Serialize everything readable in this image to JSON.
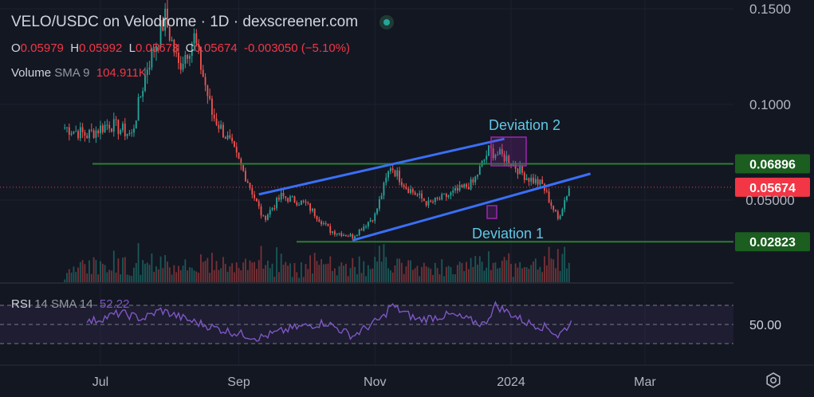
{
  "header": {
    "title": "VELO/USDC on Velodrome · 1D · dexscreener.com",
    "ohlc": [
      {
        "k": "O",
        "v": "0.05979"
      },
      {
        "k": "H",
        "v": "0.05992"
      },
      {
        "k": "L",
        "v": "0.05673"
      },
      {
        "k": "C",
        "v": "0.05674"
      }
    ],
    "change": "-0.003050 (−5.10%)",
    "volume_label": "Volume",
    "volume_sma": "SMA 9",
    "volume_value": "104.911K"
  },
  "rsi": {
    "label": "RSI",
    "params": "14 SMA 14",
    "value": "52.22",
    "axis_label": "50.00"
  },
  "colors": {
    "background": "#131722",
    "up": "#26a69a",
    "down": "#ef5350",
    "channel": "#3a6ff7",
    "level": "#2e7d32",
    "price_badge": "#f23645",
    "level_badge": "#1b5e20",
    "rsi_line": "#7e57c2",
    "annotation": "#5fc8e6"
  },
  "chart_data": {
    "type": "candlestick",
    "title": "VELO/USDC on Velodrome · 1D · dexscreener.com",
    "x_ticks": [
      "Jul",
      "Sep",
      "Nov",
      "2024",
      "Mar"
    ],
    "y_ticks": [
      "0.1500",
      "0.1000",
      "0.05000"
    ],
    "ylim": [
      0.025,
      0.155
    ],
    "price_series": [
      {
        "date": "2023-06-15",
        "close": 0.088
      },
      {
        "date": "2023-06-25",
        "close": 0.084
      },
      {
        "date": "2023-07-05",
        "close": 0.09
      },
      {
        "date": "2023-07-15",
        "close": 0.084
      },
      {
        "date": "2023-07-22",
        "close": 0.12
      },
      {
        "date": "2023-07-30",
        "close": 0.145
      },
      {
        "date": "2023-08-05",
        "close": 0.12
      },
      {
        "date": "2023-08-12",
        "close": 0.135
      },
      {
        "date": "2023-08-20",
        "close": 0.095
      },
      {
        "date": "2023-08-28",
        "close": 0.08
      },
      {
        "date": "2023-09-05",
        "close": 0.06
      },
      {
        "date": "2023-09-12",
        "close": 0.04
      },
      {
        "date": "2023-09-20",
        "close": 0.052
      },
      {
        "date": "2023-10-01",
        "close": 0.048
      },
      {
        "date": "2023-10-12",
        "close": 0.034
      },
      {
        "date": "2023-10-22",
        "close": 0.031
      },
      {
        "date": "2023-11-01",
        "close": 0.042
      },
      {
        "date": "2023-11-08",
        "close": 0.068
      },
      {
        "date": "2023-11-15",
        "close": 0.057
      },
      {
        "date": "2023-11-25",
        "close": 0.048
      },
      {
        "date": "2023-12-05",
        "close": 0.053
      },
      {
        "date": "2023-12-15",
        "close": 0.059
      },
      {
        "date": "2023-12-22",
        "close": 0.076
      },
      {
        "date": "2023-12-30",
        "close": 0.072
      },
      {
        "date": "2024-01-08",
        "close": 0.062
      },
      {
        "date": "2024-01-15",
        "close": 0.058
      },
      {
        "date": "2024-01-22",
        "close": 0.04
      },
      {
        "date": "2024-01-27",
        "close": 0.0567
      }
    ],
    "horizontal_levels": [
      {
        "label": "0.06896",
        "value": 0.06896
      },
      {
        "label": "0.02823",
        "value": 0.02823
      }
    ],
    "last_price": {
      "label": "0.05674",
      "value": 0.05674
    },
    "channel": {
      "upper": [
        {
          "date": "2023-09-10",
          "price": 0.053
        },
        {
          "date": "2023-12-29",
          "price": 0.082
        }
      ],
      "lower": [
        {
          "date": "2023-10-22",
          "price": 0.029
        },
        {
          "date": "2024-01-28",
          "price": 0.061
        }
      ]
    },
    "annotations": [
      {
        "text": "Deviation 2",
        "date": "2023-12-26",
        "price": 0.084
      },
      {
        "text": "Deviation 1",
        "date": "2023-11-28",
        "price": 0.033
      }
    ],
    "rsi_series": [
      {
        "date": "2023-06-25",
        "value": 52
      },
      {
        "date": "2023-07-10",
        "value": 62
      },
      {
        "date": "2023-07-20",
        "value": 56
      },
      {
        "date": "2023-07-28",
        "value": 65
      },
      {
        "date": "2023-08-10",
        "value": 54
      },
      {
        "date": "2023-08-25",
        "value": 44
      },
      {
        "date": "2023-09-10",
        "value": 36
      },
      {
        "date": "2023-09-25",
        "value": 46
      },
      {
        "date": "2023-10-10",
        "value": 52
      },
      {
        "date": "2023-10-22",
        "value": 38
      },
      {
        "date": "2023-11-05",
        "value": 58
      },
      {
        "date": "2023-11-08",
        "value": 70
      },
      {
        "date": "2023-11-20",
        "value": 55
      },
      {
        "date": "2023-12-05",
        "value": 60
      },
      {
        "date": "2023-12-20",
        "value": 50
      },
      {
        "date": "2023-12-25",
        "value": 70
      },
      {
        "date": "2024-01-08",
        "value": 52
      },
      {
        "date": "2024-01-18",
        "value": 46
      },
      {
        "date": "2024-01-22",
        "value": 38
      },
      {
        "date": "2024-01-28",
        "value": 52
      }
    ],
    "rsi_bands": [
      70,
      50,
      30
    ]
  }
}
